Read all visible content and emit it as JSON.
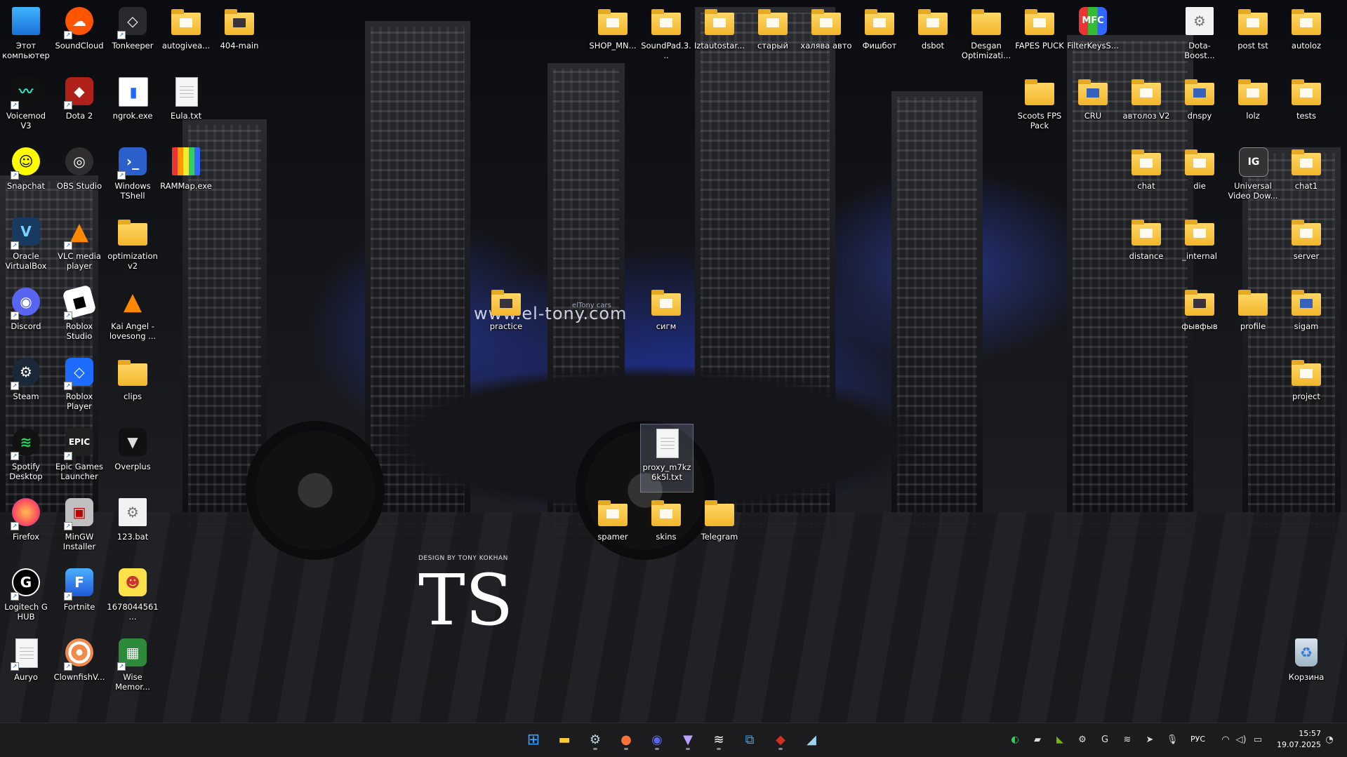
{
  "wallpaper": {
    "site_text": "www.el-tony.com",
    "site_small": "elTony cars",
    "design_credit": "DESIGN BY TONY KOKHAN",
    "logo_mark": "TS"
  },
  "desktop_icons": {
    "this_pc": "Этот компьютер",
    "soundcloud": "SoundCloud",
    "tonkeeper": "Tonkeeper",
    "autogivea": "autogivea...",
    "main404": "404-main",
    "voicemod": "Voicemod V3",
    "dota2": "Dota 2",
    "ngrok": "ngrok.exe",
    "eula": "Eula.txt",
    "snapchat": "Snapchat",
    "obs": "OBS Studio",
    "tshell": "Windows TShell",
    "rammap": "RAMMap.exe",
    "virtualbox": "Oracle VirtualBox",
    "vlc": "VLC media player",
    "optimization": "optimization v2",
    "discord": "Discord",
    "roblox_studio": "Roblox Studio",
    "kai_angel": "Kai Angel - lovesong ...",
    "steam": "Steam",
    "roblox_player": "Roblox Player",
    "clips": "clips",
    "spotify": "Spotify Desktop",
    "epic": "Epic Games Launcher",
    "overplus": "Overplus",
    "firefox": "Firefox",
    "mingw": "MinGW Installer",
    "bat123": "123.bat",
    "logitech": "Logitech G HUB",
    "fortnite": "Fortnite",
    "image167": "1678044561...",
    "auryo": "Auryo",
    "clownfish": "ClownfishV...",
    "wise": "Wise Memor...",
    "practice": "practice",
    "sigm": "сигм",
    "proxy": "proxy_m7kz6k5l.txt",
    "spamer": "spamer",
    "skins": "skins",
    "telegram": "Telegram",
    "shop": "SHOP_MN...",
    "soundpad": "SoundPad.3...",
    "iztautostar": "Iztautostar...",
    "stary": "старый",
    "khalyava": "халява авто",
    "fishbot": "Фишбот",
    "dsbot": "dsbot",
    "desgan": "Desgan Optimizati...",
    "fapes": "FAPES PUCK",
    "filterkeys": "FilterKeysS...",
    "dota_boost": "Dota-Boost...",
    "post_tst": "post tst",
    "autoloz": "autoloz",
    "scoots": "Scoots FPS Pack",
    "cru": "CRU",
    "avtolots": "автолоз V2",
    "dnspy": "dnspy",
    "lolz": "lolz",
    "tests": "tests",
    "chat": "chat",
    "die": "die",
    "uvd": "Universal Video Dow...",
    "chat1": "chat1",
    "distance": "distance",
    "internal": "_internal",
    "server": "server",
    "fyvfyv": "фывфыв",
    "profile": "profile",
    "sigam": "sigam",
    "project": "project",
    "recycle": "Корзина"
  },
  "taskbar": {
    "language": "РУС",
    "time": "15:57",
    "date": "19.07.2025"
  },
  "colors": {
    "taskbar_bg": "#1c1c1f",
    "folder_yellow": "#f2b52a",
    "accent_blue": "#2f55ff"
  }
}
